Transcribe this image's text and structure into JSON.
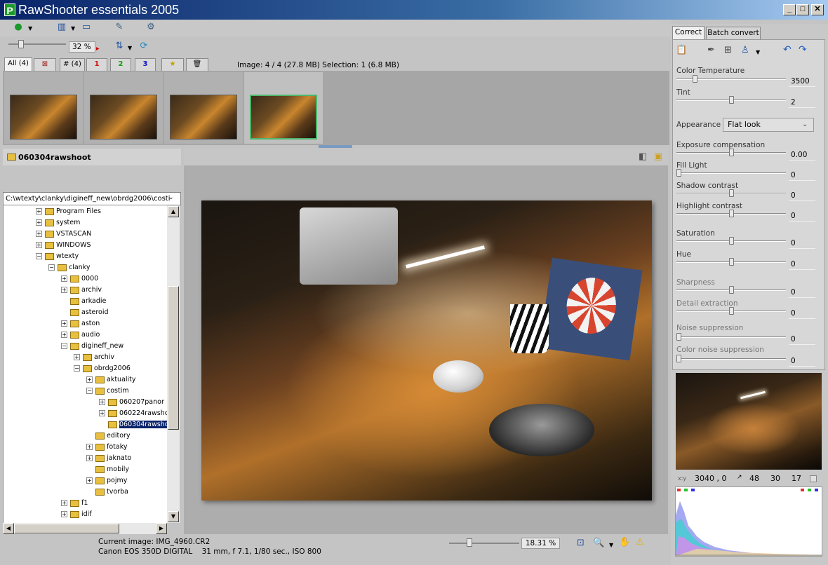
{
  "app": {
    "title": "RawShooter essentials 2005",
    "logo_letter": "P"
  },
  "window_controls": {
    "minimize": "_",
    "maximize": "□",
    "close": "✕"
  },
  "toolbar": {
    "zoom_value": "32 %",
    "icons": [
      "help-icon",
      "layout-icon",
      "single-view-icon",
      "comment-icon",
      "settings-icon",
      "sort-icon",
      "refresh-icon"
    ]
  },
  "filter_tabs": [
    {
      "label": "All (4)",
      "color": "#000000"
    },
    {
      "label": "⊠",
      "color": "#000000"
    },
    {
      "label": "# (4)",
      "color": "#000000"
    },
    {
      "label": "1",
      "color": "#d01010"
    },
    {
      "label": "2",
      "color": "#10a010"
    },
    {
      "label": "3",
      "color": "#1010c0"
    },
    {
      "label": "★",
      "color": "#c0a000"
    },
    {
      "label": "🗑",
      "color": "#2080c0"
    }
  ],
  "image_info": "Image: 4 / 4 (27.8 MB) Selection: 1 (6.8 MB)",
  "thumbnails": [
    {
      "file": "",
      "selected": false
    },
    {
      "file": "",
      "selected": false
    },
    {
      "file": "",
      "selected": false
    },
    {
      "file": "",
      "selected": true
    }
  ],
  "folder_panel": {
    "title": "060304rawshoot",
    "path": "C:\\wtexty\\clanky\\digineff_new\\obrdg2006\\costi"
  },
  "tree": [
    {
      "label": "Program Files",
      "expander": "+",
      "indent": 0
    },
    {
      "label": "system",
      "expander": "+",
      "indent": 0
    },
    {
      "label": "VSTASCAN",
      "expander": "+",
      "indent": 0
    },
    {
      "label": "WINDOWS",
      "expander": "+",
      "indent": 0
    },
    {
      "label": "wtexty",
      "expander": "−",
      "indent": 0
    },
    {
      "label": "clanky",
      "expander": "−",
      "indent": 1
    },
    {
      "label": "0000",
      "expander": "+",
      "indent": 2
    },
    {
      "label": "archiv",
      "expander": "+",
      "indent": 2
    },
    {
      "label": "arkadie",
      "expander": "",
      "indent": 2
    },
    {
      "label": "asteroid",
      "expander": "",
      "indent": 2
    },
    {
      "label": "aston",
      "expander": "+",
      "indent": 2
    },
    {
      "label": "audio",
      "expander": "+",
      "indent": 2
    },
    {
      "label": "digineff_new",
      "expander": "−",
      "indent": 2
    },
    {
      "label": "archiv",
      "expander": "+",
      "indent": 3
    },
    {
      "label": "obrdg2006",
      "expander": "−",
      "indent": 3
    },
    {
      "label": "aktuality",
      "expander": "+",
      "indent": 4
    },
    {
      "label": "costim",
      "expander": "−",
      "indent": 4
    },
    {
      "label": "060207panor",
      "expander": "+",
      "indent": 5
    },
    {
      "label": "060224rawshc",
      "expander": "+",
      "indent": 5
    },
    {
      "label": "060304rawsho",
      "expander": "",
      "indent": 5,
      "selected": true
    },
    {
      "label": "editory",
      "expander": "",
      "indent": 4
    },
    {
      "label": "fotaky",
      "expander": "+",
      "indent": 4
    },
    {
      "label": "jaknato",
      "expander": "+",
      "indent": 4
    },
    {
      "label": "mobily",
      "expander": "",
      "indent": 4
    },
    {
      "label": "pojmy",
      "expander": "+",
      "indent": 4
    },
    {
      "label": "tvorba",
      "expander": "",
      "indent": 4
    },
    {
      "label": "f1",
      "expander": "+",
      "indent": 2
    },
    {
      "label": "idif",
      "expander": "+",
      "indent": 2
    }
  ],
  "status": {
    "current_image": "Current image: IMG_4960.CR2",
    "camera_info": "Canon EOS 350D DIGITAL    31 mm, f 7.1, 1/80 sec., ISO 800",
    "zoom": "18.31 %"
  },
  "right_tabs": {
    "correct": "Correct",
    "batch": "Batch convert"
  },
  "adjustments": {
    "color_temperature": {
      "label": "Color Temperature",
      "value": "3500",
      "level": 0.15
    },
    "tint": {
      "label": "Tint",
      "value": "2",
      "level": 0.5
    },
    "appearance": {
      "label": "Appearance",
      "value": "Flat look"
    },
    "exposure": {
      "label": "Exposure compensation",
      "value": "0.00",
      "level": 0.5
    },
    "fill_light": {
      "label": "Fill Light",
      "value": "0",
      "level": 0
    },
    "shadow_contrast": {
      "label": "Shadow contrast",
      "value": "0",
      "level": 0.5
    },
    "highlight_contrast": {
      "label": "Highlight contrast",
      "value": "0",
      "level": 0.5
    },
    "saturation": {
      "label": "Saturation",
      "value": "0",
      "level": 0.5
    },
    "hue": {
      "label": "Hue",
      "value": "0",
      "level": 0.5
    },
    "sharpness": {
      "label": "Sharpness",
      "value": "0",
      "level": 0.5
    },
    "detail_extraction": {
      "label": "Detail extraction",
      "value": "0",
      "level": 0.5
    },
    "noise_suppression": {
      "label": "Noise suppression",
      "value": "0",
      "level": 0
    },
    "color_noise_suppression": {
      "label": "Color noise suppression",
      "value": "0",
      "level": 0
    }
  },
  "pixel_readout": {
    "xy_label": "x:y",
    "xy": "3040 , 0",
    "r": "48",
    "g": "30",
    "b": "17"
  }
}
